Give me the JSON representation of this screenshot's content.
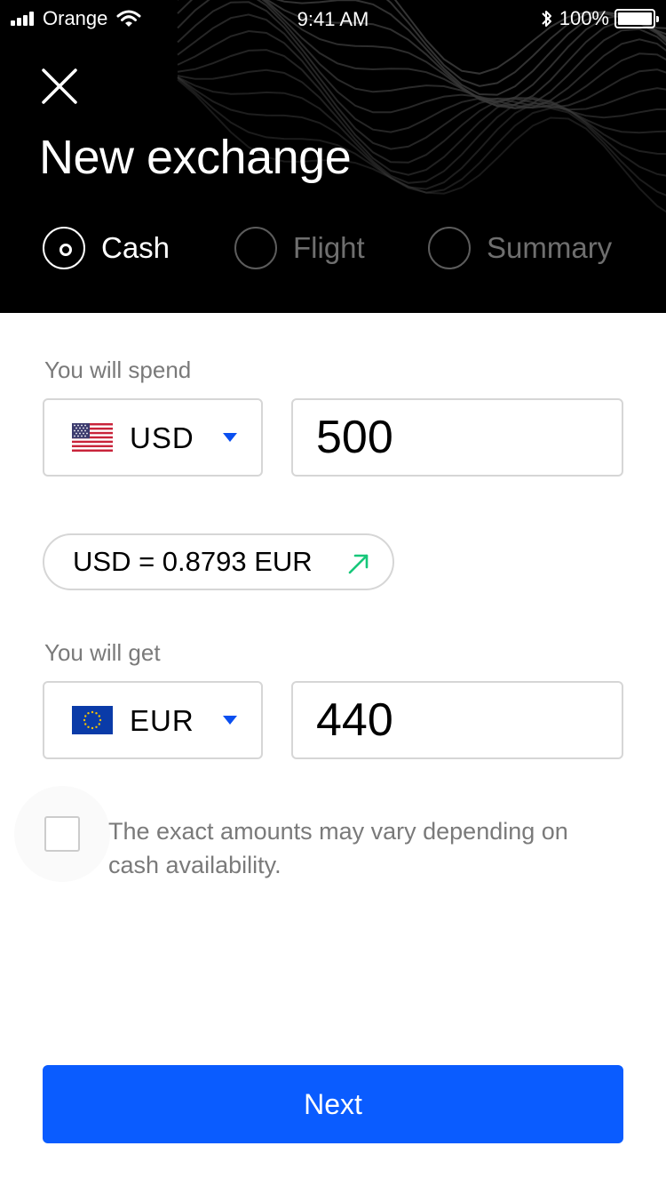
{
  "status_bar": {
    "carrier": "Orange",
    "time": "9:41 AM",
    "battery": "100%",
    "icons": [
      "signal-icon",
      "wifi-icon",
      "bluetooth-icon",
      "battery-icon"
    ]
  },
  "header": {
    "close_icon": "close-icon",
    "title": "New exchange",
    "steps": [
      {
        "label": "Cash",
        "active": true
      },
      {
        "label": "Flight",
        "active": false
      },
      {
        "label": "Summary",
        "active": false
      }
    ]
  },
  "spend": {
    "label": "You will spend",
    "currency": "USD",
    "flag_icon": "us-flag-icon",
    "amount": "500"
  },
  "rate": {
    "text": "USD = 0.8793 EUR",
    "trend_icon": "arrow-up-right-icon"
  },
  "get": {
    "label": "You will get",
    "currency": "EUR",
    "flag_icon": "eu-flag-icon",
    "amount": "440"
  },
  "disclaimer": {
    "checked": false,
    "text": "The exact amounts may vary depending on cash availability."
  },
  "next_button": {
    "label": "Next"
  },
  "colors": {
    "accent": "#0a5cff",
    "caret": "#0a4ff0",
    "trend_up": "#17c77a",
    "header_bg": "#000000"
  }
}
